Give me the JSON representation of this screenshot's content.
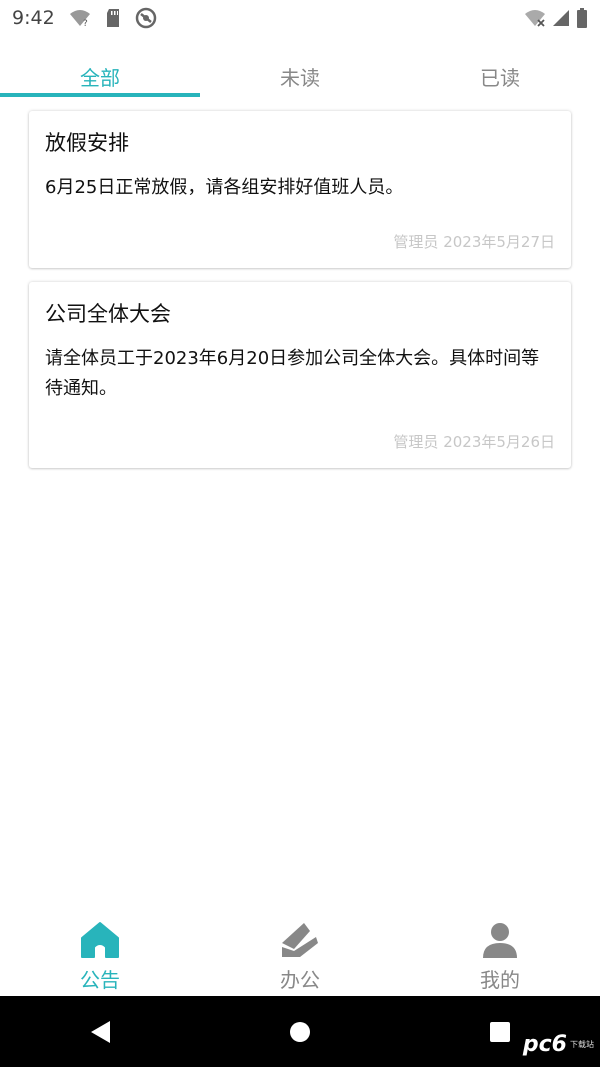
{
  "status": {
    "time": "9:42",
    "icons": [
      "wifi-question-icon",
      "sd-card-icon",
      "no-disturb-icon",
      "wifi-off-icon",
      "signal-icon",
      "battery-icon"
    ]
  },
  "tabs": [
    {
      "label": "全部",
      "active": true
    },
    {
      "label": "未读",
      "active": false
    },
    {
      "label": "已读",
      "active": false
    }
  ],
  "notices": [
    {
      "title": "放假安排",
      "body": "6月25日正常放假，请各组安排好值班人员。",
      "meta": "管理员 2023年5月27日"
    },
    {
      "title": "公司全体大会",
      "body": "请全体员工于2023年6月20日参加公司全体大会。具体时间等待通知。",
      "meta": "管理员 2023年5月26日"
    }
  ],
  "bottom_nav": [
    {
      "label": "公告",
      "icon": "home-icon",
      "active": true
    },
    {
      "label": "办公",
      "icon": "office-icon",
      "active": false
    },
    {
      "label": "我的",
      "icon": "user-icon",
      "active": false
    }
  ],
  "watermark": {
    "logo": "pc6",
    "sub": "下载站"
  },
  "colors": {
    "accent": "#28b4bb",
    "inactive": "#888888",
    "meta": "#c7c7c7"
  }
}
